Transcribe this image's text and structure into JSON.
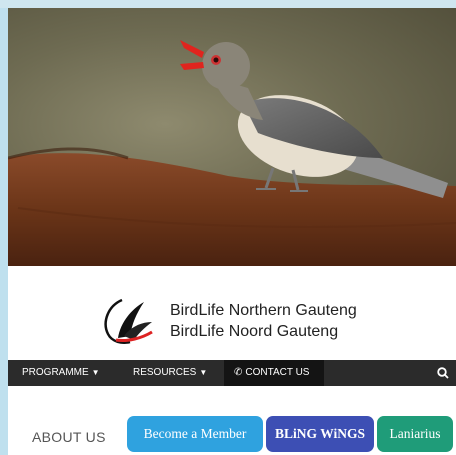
{
  "site": {
    "brand_line1": "BirdLife Northern Gauteng",
    "brand_line2": "BirdLife Noord Gauteng",
    "logo_icon": "birdlife-wing-logo-icon"
  },
  "nav": {
    "items": [
      {
        "label": "PROGRAMME",
        "has_dropdown": true
      },
      {
        "label": "RESOURCES",
        "has_dropdown": true
      },
      {
        "label": "CONTACT US",
        "icon": "phone-icon"
      }
    ],
    "search_icon": "search-icon",
    "background": "#2b2b2b"
  },
  "hero": {
    "image_subject": "red-billed-oxpecker-photo"
  },
  "main": {
    "about_label": "ABOUT US",
    "buttons": [
      {
        "label": "Become a Member",
        "color": "#2fa2df"
      },
      {
        "label": "BLiNG WiNGS",
        "color": "#3d4fb4"
      },
      {
        "label": "Laniarius",
        "color": "#1f9c79"
      }
    ]
  }
}
